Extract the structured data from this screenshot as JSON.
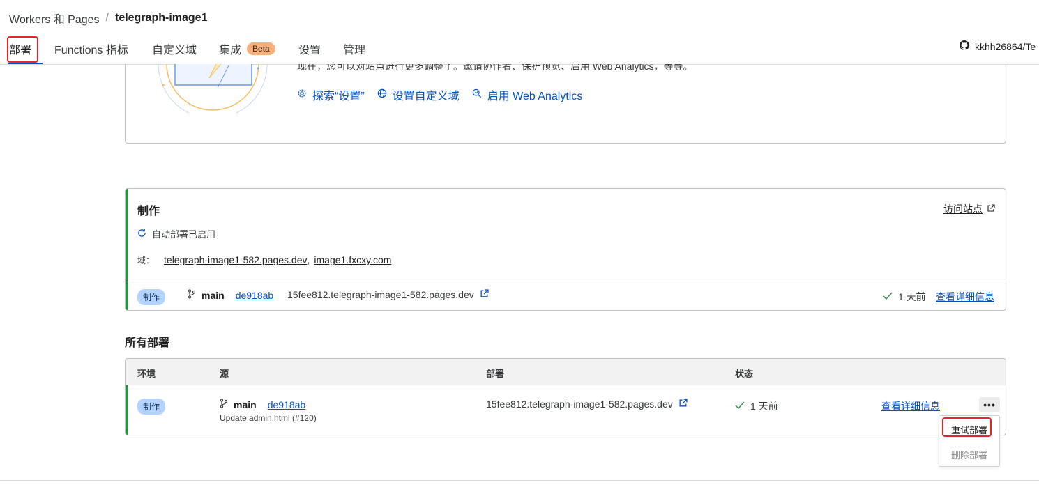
{
  "breadcrumb": {
    "parent": "Workers 和 Pages",
    "separator": "/",
    "current": "telegraph-image1"
  },
  "tabs": [
    {
      "label": "部署"
    },
    {
      "label": "Functions 指标"
    },
    {
      "label": "自定义域"
    },
    {
      "label": "集成",
      "badge": "Beta"
    },
    {
      "label": "设置"
    },
    {
      "label": "管理"
    }
  ],
  "repo": {
    "label": "kkhh26864/Te",
    "icon": "github-icon"
  },
  "intro": {
    "description": "现在，您可以对站点进行更多调整了。邀请协作者、保护预览、启用 Web Analytics，等等。",
    "links": [
      {
        "label": "探索“设置”",
        "icon": "gear-icon"
      },
      {
        "label": "设置自定义域",
        "icon": "globe-icon"
      },
      {
        "label": "启用 Web Analytics",
        "icon": "analytics-icon"
      }
    ]
  },
  "production": {
    "title": "制作",
    "visit_label": "访问站点",
    "auto_deploy": "自动部署已启用",
    "domains_label": "域：",
    "domains": [
      "telegraph-image1-582.pages.dev",
      "image1.fxcxy.com"
    ],
    "domain_sep": ",",
    "row": {
      "env": "制作",
      "branch": "main",
      "commit": "de918ab",
      "url": "15fee812.telegraph-image1-582.pages.dev",
      "time": "1 天前",
      "details": "查看详细信息"
    }
  },
  "all_deployments": {
    "title": "所有部署",
    "columns": [
      "环境",
      "源",
      "部署",
      "状态"
    ],
    "rows": [
      {
        "env": "制作",
        "branch": "main",
        "commit": "de918ab",
        "message": "Update admin.html (#120)",
        "url": "15fee812.telegraph-image1-582.pages.dev",
        "status": "1 天前",
        "details": "查看详细信息"
      }
    ],
    "more_label": "•••",
    "menu": {
      "retry": "重试部署",
      "delete": "删除部署"
    }
  },
  "colors": {
    "accent_blue": "#0051c3",
    "success_green": "#2d8f4a",
    "highlight_red": "#e5252d",
    "beta_orange": "#f7b07a",
    "env_badge_blue": "#b5d3ff"
  }
}
